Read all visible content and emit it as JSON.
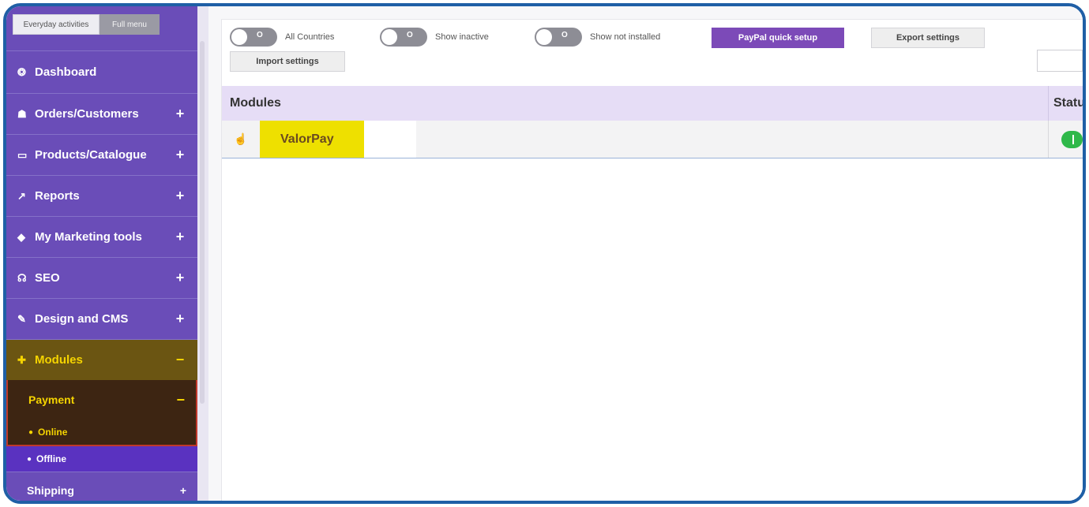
{
  "sidebar": {
    "tabs": [
      {
        "label": "Everyday activities"
      },
      {
        "label": "Full menu"
      }
    ],
    "items": [
      {
        "label": "Dashboard",
        "icon": "dashboard-icon",
        "glyph": "❂",
        "toggle": ""
      },
      {
        "label": "Orders/Customers",
        "icon": "users-icon",
        "glyph": "☗",
        "toggle": "+"
      },
      {
        "label": "Products/Catalogue",
        "icon": "folder-icon",
        "glyph": "▭",
        "toggle": "+"
      },
      {
        "label": "Reports",
        "icon": "chart-icon",
        "glyph": "↗",
        "toggle": "+"
      },
      {
        "label": "My Marketing tools",
        "icon": "tag-icon",
        "glyph": "◆",
        "toggle": "+"
      },
      {
        "label": "SEO",
        "icon": "sitemap-icon",
        "glyph": "☊",
        "toggle": "+"
      },
      {
        "label": "Design and CMS",
        "icon": "brush-icon",
        "glyph": "✎",
        "toggle": "+"
      },
      {
        "label": "Modules",
        "icon": "puzzle-icon",
        "glyph": "✚",
        "toggle": "−"
      }
    ],
    "payment": {
      "label": "Payment",
      "toggle": "−"
    },
    "online": {
      "label": "Online"
    },
    "offline": {
      "label": "Offline"
    },
    "shipping": {
      "label": "Shipping",
      "toggle": "+"
    }
  },
  "toolbar": {
    "toggles": [
      {
        "label": "All Countries",
        "knob_text": "O"
      },
      {
        "label": "Show inactive",
        "knob_text": "O"
      },
      {
        "label": "Show not installed",
        "knob_text": "O"
      }
    ],
    "paypal_label": "PayPal quick setup",
    "export_label": "Export settings",
    "import_label": "Import settings"
  },
  "table": {
    "headers": {
      "modules": "Modules",
      "status": "Status"
    },
    "rows": [
      {
        "name": "ValorPay",
        "status": "on"
      }
    ]
  },
  "colors": {
    "sidebar": "#6a4db8",
    "active_module": "#f5d400",
    "paypal_button": "#7c4ab8",
    "status_on": "#2fb84a",
    "highlight": "#eee000",
    "frame": "#1f5fa6"
  }
}
